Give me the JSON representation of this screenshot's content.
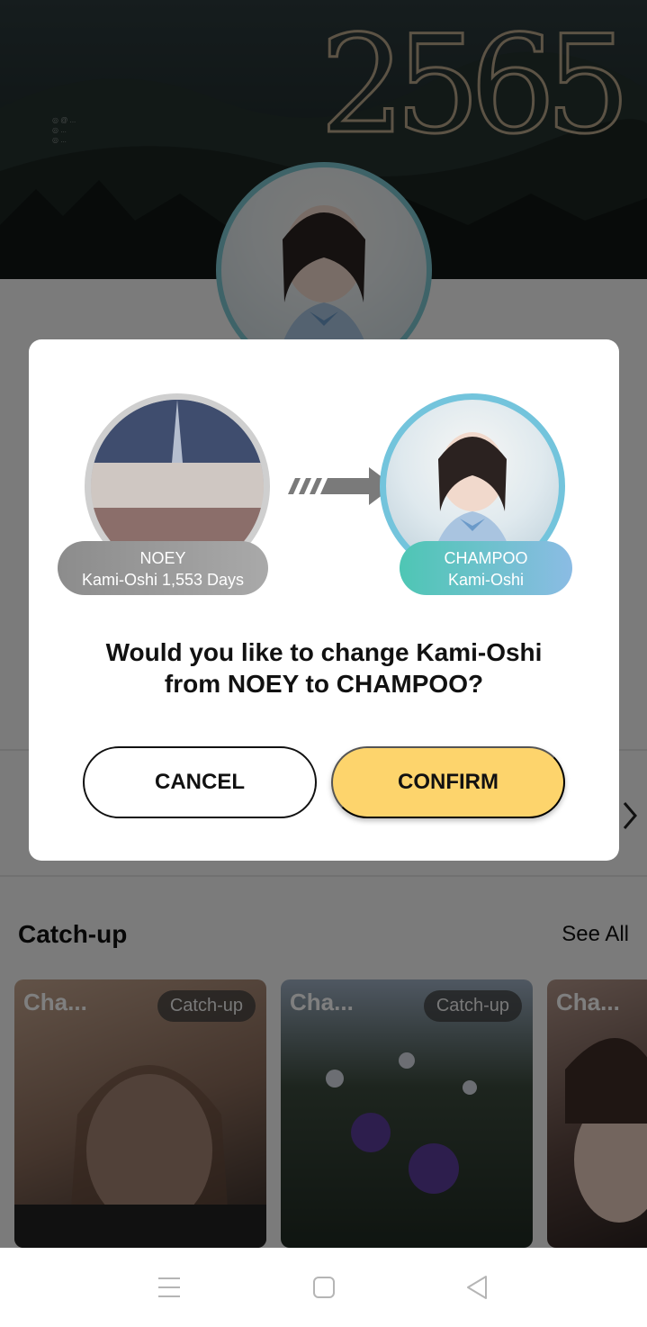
{
  "cover": {
    "year_text": "2565",
    "small_lines": [
      "◎ @ ...",
      "◎ ...",
      "◎ ..."
    ]
  },
  "catchup_section": {
    "title": "Catch-up",
    "see_all": "See All",
    "cards": [
      {
        "title": "Cha...",
        "badge": "Catch-up"
      },
      {
        "title": "Cha...",
        "badge": "Catch-up"
      },
      {
        "title": "Cha..."
      }
    ]
  },
  "dialog": {
    "from": {
      "name": "NOEY",
      "detail": "Kami-Oshi 1,553 Days"
    },
    "to": {
      "name": "CHAMPOO",
      "detail": "Kami-Oshi"
    },
    "question_line1": "Would you like to change Kami-Oshi",
    "question_line2": "from NOEY to CHAMPOO?",
    "cancel_label": "CANCEL",
    "confirm_label": "CONFIRM"
  },
  "navbar": {
    "icons": [
      "menu-icon",
      "home-square-icon",
      "back-triangle-icon"
    ]
  },
  "colors": {
    "confirm_bg": "#fdd46c",
    "to_ring": "#73c4dc",
    "to_pill_start": "#4ec6b4",
    "to_pill_end": "#8bbce4",
    "from_pill": "#9a9a9a"
  }
}
